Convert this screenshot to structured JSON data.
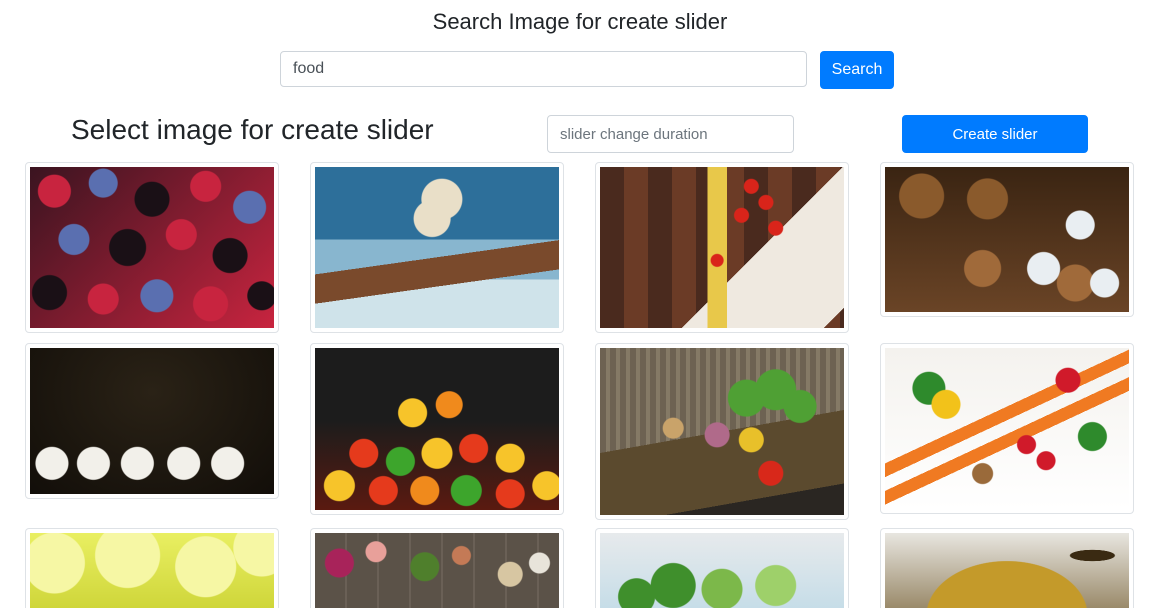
{
  "header": {
    "title": "Search Image for create slider"
  },
  "search": {
    "value": "food",
    "button_label": "Search"
  },
  "slider_section": {
    "heading": "Select image for create slider",
    "duration_placeholder": "slider change duration",
    "create_button_label": "Create slider"
  },
  "images": [
    {
      "subject": "berries",
      "palette": [
        "#3a1420",
        "#c8243f",
        "#5a6fb0",
        "#1a1016"
      ]
    },
    {
      "subject": "ice-cream-cone",
      "palette": [
        "#2d6f9a",
        "#88b6cf",
        "#e9dfc8",
        "#7a4a2c"
      ]
    },
    {
      "subject": "pasta-tomatoes-wooden-table",
      "palette": [
        "#4a2a1e",
        "#6b3b26",
        "#d9241a",
        "#e8c84a"
      ]
    },
    {
      "subject": "cinnamon-walnuts-star-cookies",
      "palette": [
        "#3a2412",
        "#8a5a2c",
        "#e9eef2",
        "#a06a3a"
      ]
    },
    {
      "subject": "soup-bowls-dark-table",
      "palette": [
        "#2a2216",
        "#120e09",
        "#f2f0ea",
        "#c0421c"
      ]
    },
    {
      "subject": "gummy-bears",
      "palette": [
        "#1c1c1c",
        "#e53a1c",
        "#f7c42a",
        "#3da52c"
      ]
    },
    {
      "subject": "vegetable-basket",
      "palette": [
        "#6d6252",
        "#5b4a2e",
        "#4fa034",
        "#d8281a"
      ]
    },
    {
      "subject": "carrots-vegetables",
      "palette": [
        "#f4f2ee",
        "#f07a22",
        "#2e8a2c",
        "#d01a2a"
      ]
    },
    {
      "subject": "lemon-slices",
      "palette": [
        "#e9ef62",
        "#f6f7a4",
        "#cfd63a",
        "#ffffff"
      ]
    },
    {
      "subject": "salad-ingredients-table",
      "palette": [
        "#5b5248",
        "#4f7f2c",
        "#a8235a",
        "#d7c6a2"
      ]
    },
    {
      "subject": "lettuce-water-splash",
      "palette": [
        "#e7eaec",
        "#3f8f2c",
        "#c6dde8",
        "#7cb84a"
      ]
    },
    {
      "subject": "olive-oil-jar",
      "palette": [
        "#e8e6e0",
        "#c49a2a",
        "#3a2a12",
        "#9a8a6a"
      ]
    }
  ]
}
